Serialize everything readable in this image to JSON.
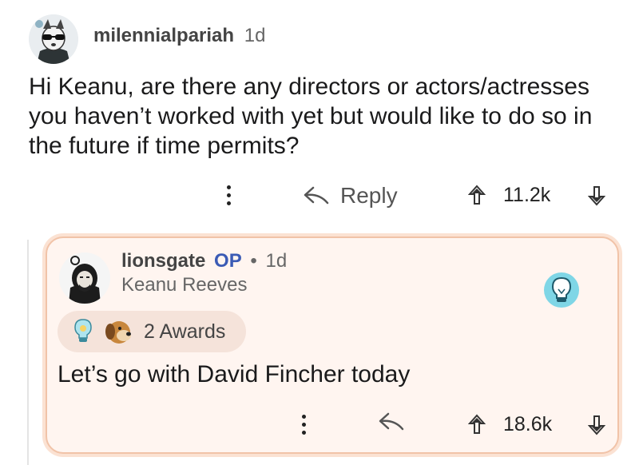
{
  "post_comment": {
    "username": "milennialpariah",
    "age": "1d",
    "body": "Hi Keanu, are there any directors or actors/actresses you haven’t worked with yet but would like to do so in the future if time permits?",
    "reply_label": "Reply",
    "vote_count": "11.2k",
    "icons": [
      "avatar",
      "more-icon",
      "reply-icon",
      "upvote-icon",
      "downvote-icon"
    ]
  },
  "reply_comment": {
    "username": "lionsgate",
    "op_badge": "OP",
    "separator": "•",
    "age": "1d",
    "flair": "Keanu Reeves",
    "awards_label": "2 Awards",
    "body": "Let’s go with David Fincher today",
    "vote_count": "18.6k",
    "highlight_color": "#f1c3a8",
    "op_color": "#3b5bb5",
    "icons": [
      "avatar",
      "lightbulb-icon",
      "dog-award-icon",
      "more-icon",
      "reply-icon",
      "upvote-icon",
      "downvote-icon"
    ]
  }
}
